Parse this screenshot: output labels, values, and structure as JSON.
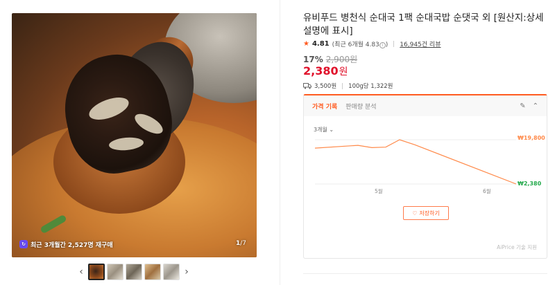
{
  "gallery": {
    "badge_text": "최근 3개월간 2,527명 재구매",
    "counter_current": "1",
    "counter_total": "/7",
    "thumbnail_count": 5
  },
  "product": {
    "title": "유비푸드 병천식 순대국 1팩 순대국밥 순댓국 외 [원산지:상세설명에 표시]",
    "rating": "4.81",
    "rating_recent": "(최근 6개월 4.83",
    "rating_recent_close": ")",
    "review_count": "16,945건 리뷰",
    "discount_rate": "17%",
    "original_price": "2,900원",
    "price": "2,380",
    "price_unit": "원",
    "shipping_fee": "3,500원",
    "unit_price": "100g당 1,322원"
  },
  "price_history": {
    "tab_active": "가격 기록",
    "tab_other": "판매량 분석",
    "period": "3개월",
    "save_button": "저장하기",
    "credit": "AiPrice 기술 지원"
  },
  "chart_data": {
    "type": "line",
    "x": [
      "start",
      "p2",
      "p3",
      "p4",
      "p5",
      "p6",
      "end"
    ],
    "xtick_labels": [
      "5월",
      "6월"
    ],
    "series": [
      {
        "values": [
          16500,
          17600,
          16700,
          16900,
          19800,
          17800,
          2380
        ]
      }
    ],
    "max_label": "₩19,800",
    "min_label": "₩2,380",
    "accent_color": "#ff8a4a"
  },
  "colors": {
    "accent": "#ff5a1f",
    "price_red": "#e0102a",
    "badge_purple": "#6b4cff"
  }
}
